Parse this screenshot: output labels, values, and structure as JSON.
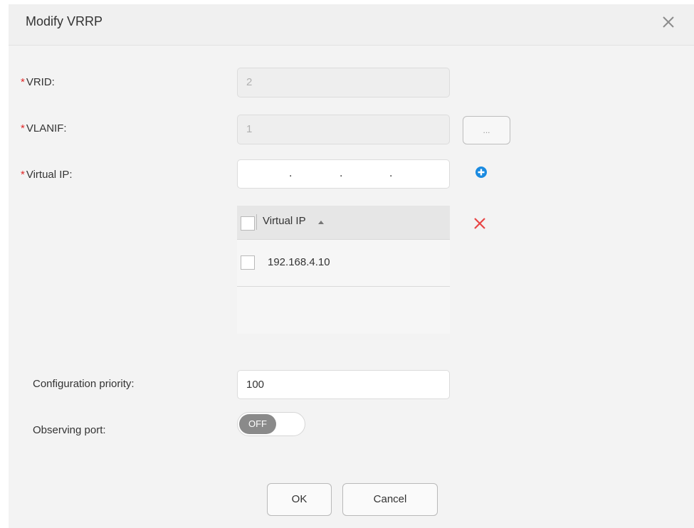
{
  "dialog": {
    "title": "Modify VRRP",
    "close_icon": "close-icon"
  },
  "form": {
    "vrid": {
      "required_mark": "*",
      "label": "VRID:",
      "value": "2"
    },
    "vlanif": {
      "required_mark": "*",
      "label": "VLANIF:",
      "value": "1",
      "select_button_label": "..."
    },
    "virtual_ip": {
      "required_mark": "*",
      "label": "Virtual IP:",
      "separators": [
        ".",
        ".",
        "."
      ],
      "add_icon": "plus-circle-icon"
    },
    "ip_table": {
      "header": "Virtual IP",
      "sort_icon": "sort-ascending-icon",
      "delete_icon": "delete-x-icon",
      "rows": [
        "192.168.4.10"
      ]
    },
    "configuration_priority": {
      "label": "Configuration priority:",
      "value": "100"
    },
    "observing_port": {
      "label": "Observing port:",
      "toggle_text": "OFF"
    }
  },
  "footer": {
    "ok_label": "OK",
    "cancel_label": "Cancel"
  },
  "colors": {
    "required": "#e02828",
    "add_icon": "#1a8ae0",
    "delete_icon": "#e84545"
  }
}
